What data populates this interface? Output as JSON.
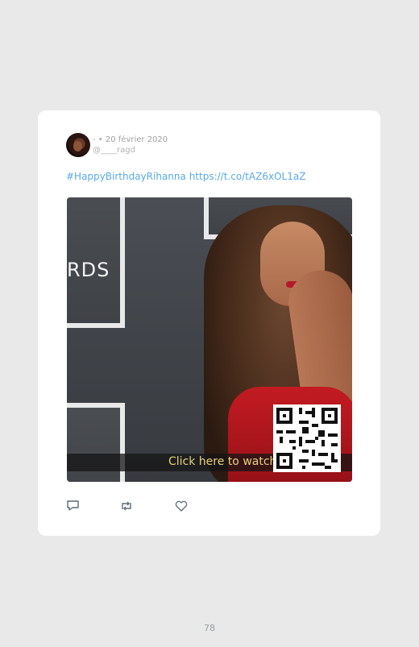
{
  "tweet": {
    "meta_line": "- • 20 février 2020",
    "handle": "@____ragd",
    "hashtag": "#HappyBirthdayRihanna",
    "link": "https://t.co/tAZ6xOL1aZ"
  },
  "media": {
    "background_text": "RDS",
    "caption": "Click here to watch the live"
  },
  "actions": {
    "icons": [
      "reply-icon",
      "retweet-icon",
      "like-icon"
    ]
  },
  "page": {
    "number": "78"
  },
  "colors": {
    "link": "#5aa9e6",
    "card": "#ffffff",
    "page_bg": "#e8e9e8"
  }
}
